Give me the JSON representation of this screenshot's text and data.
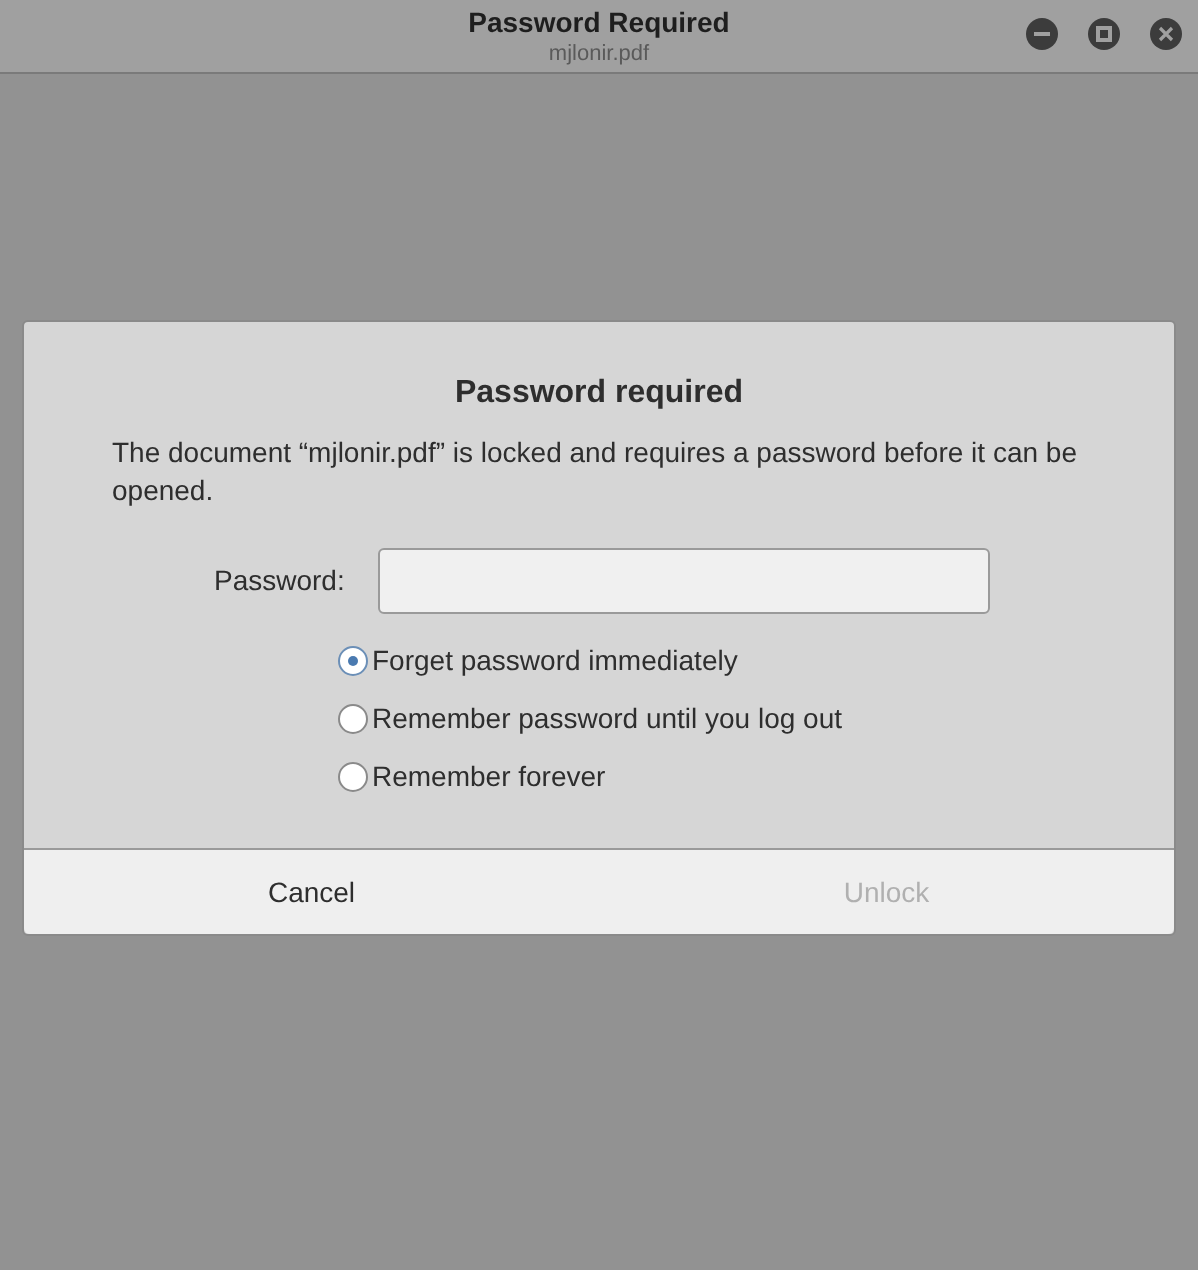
{
  "window": {
    "title": "Password Required",
    "subtitle": "mjlonir.pdf"
  },
  "dialog": {
    "title": "Password required",
    "message": "The document “mjlonir.pdf” is locked and requires a password before it can be opened.",
    "password": {
      "label": "Password:"
    },
    "options": [
      {
        "label": "Forget password immediately",
        "selected": true
      },
      {
        "label": "Remember password until you log out",
        "selected": false
      },
      {
        "label": "Remember forever",
        "selected": false
      }
    ],
    "buttons": [
      {
        "label": "Cancel",
        "disabled": false
      },
      {
        "label": "Unlock",
        "disabled": true
      }
    ]
  }
}
